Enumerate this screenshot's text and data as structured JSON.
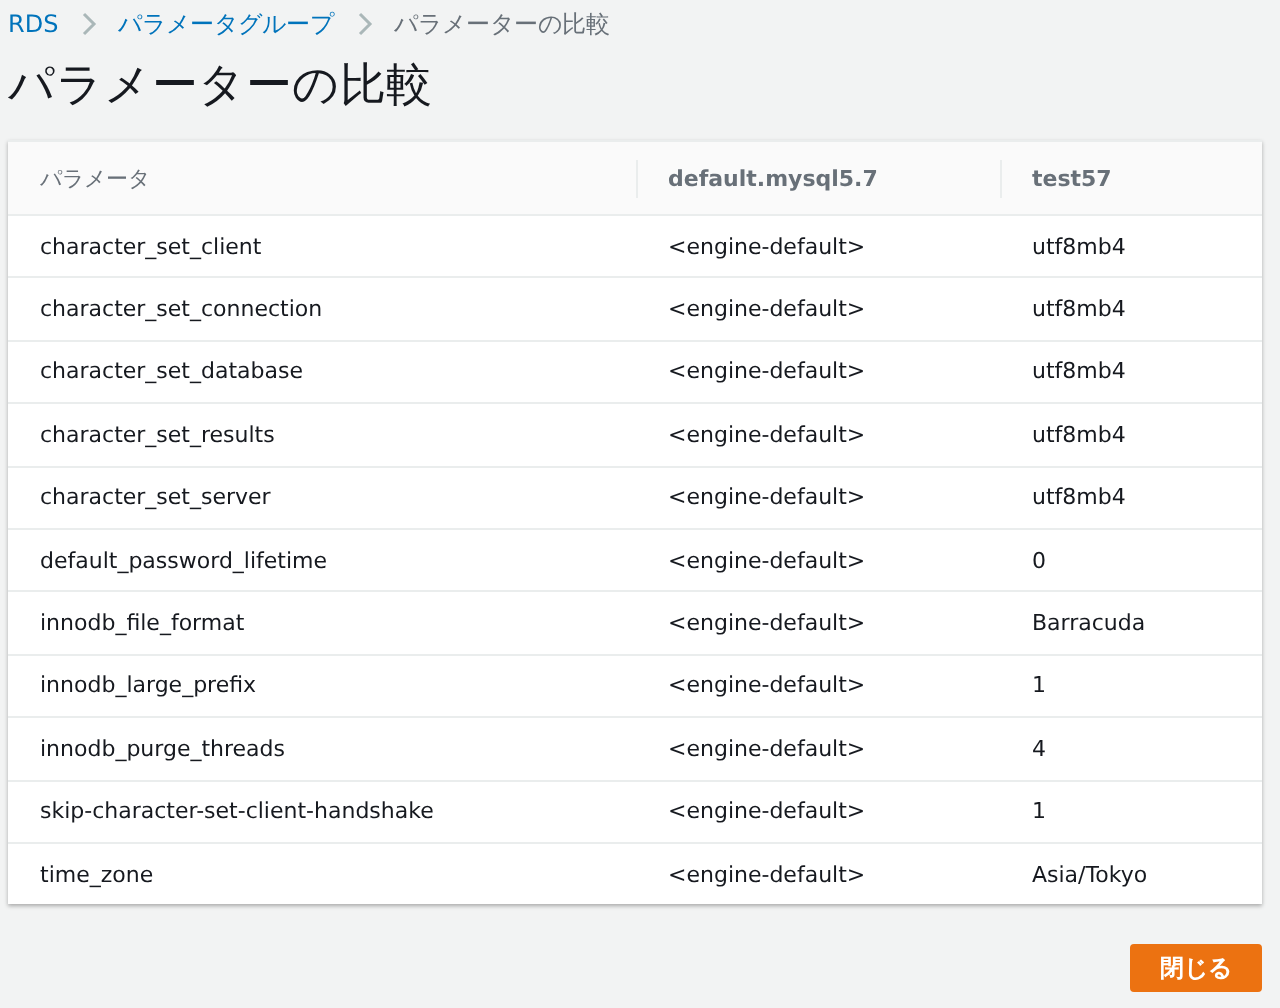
{
  "breadcrumb": [
    {
      "label": "RDS",
      "kind": "link"
    },
    {
      "label": "パラメータグループ",
      "kind": "link"
    },
    {
      "label": "パラメーターの比較",
      "kind": "current"
    }
  ],
  "title": "パラメーターの比較",
  "table": {
    "columns": [
      "パラメータ",
      "default.mysql5.7",
      "test57"
    ],
    "rows": [
      [
        "character_set_client",
        "<engine-default>",
        "utf8mb4"
      ],
      [
        "character_set_connection",
        "<engine-default>",
        "utf8mb4"
      ],
      [
        "character_set_database",
        "<engine-default>",
        "utf8mb4"
      ],
      [
        "character_set_results",
        "<engine-default>",
        "utf8mb4"
      ],
      [
        "character_set_server",
        "<engine-default>",
        "utf8mb4"
      ],
      [
        "default_password_lifetime",
        "<engine-default>",
        "0"
      ],
      [
        "innodb_file_format",
        "<engine-default>",
        "Barracuda"
      ],
      [
        "innodb_large_prefix",
        "<engine-default>",
        "1"
      ],
      [
        "innodb_purge_threads",
        "<engine-default>",
        "4"
      ],
      [
        "skip-character-set-client-handshake",
        "<engine-default>",
        "1"
      ],
      [
        "time_zone",
        "<engine-default>",
        "Asia/Tokyo"
      ]
    ]
  },
  "buttons": [
    "閉じる"
  ]
}
